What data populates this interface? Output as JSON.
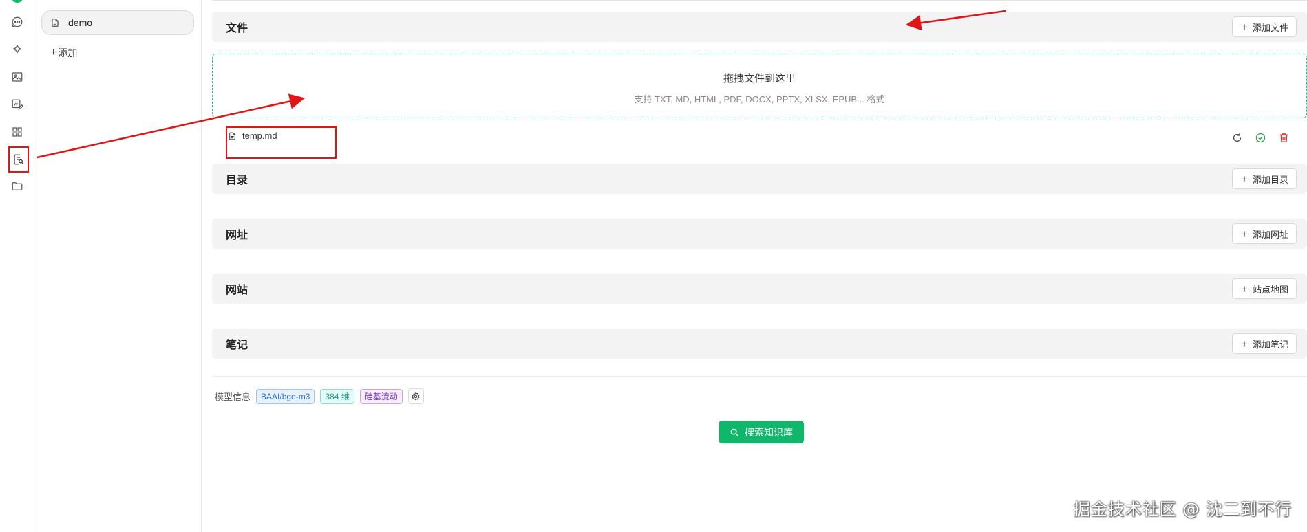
{
  "rail": {
    "icons": [
      "chat-icon",
      "sparkle-icon",
      "image-icon",
      "image-edit-icon",
      "apps-grid-icon",
      "knowledge-base-icon",
      "folder-icon"
    ],
    "active": "knowledge-base-icon"
  },
  "knowledge_list": {
    "items": [
      {
        "label": "demo"
      }
    ],
    "add_label": "添加"
  },
  "sections": {
    "files": {
      "title": "文件",
      "button": "添加文件"
    },
    "directories": {
      "title": "目录",
      "button": "添加目录"
    },
    "urls": {
      "title": "网址",
      "button": "添加网址"
    },
    "websites": {
      "title": "网站",
      "button": "站点地图"
    },
    "notes": {
      "title": "笔记",
      "button": "添加笔记"
    }
  },
  "dropzone": {
    "title": "拖拽文件到这里",
    "subtitle": "支持 TXT, MD, HTML, PDF, DOCX, PPTX, XLSX, EPUB... 格式"
  },
  "files": [
    {
      "name": "temp.md",
      "status": "ok"
    }
  ],
  "model_info": {
    "label": "模型信息",
    "model": "BAAI/bge-m3",
    "dimensions": "384 维",
    "provider": "硅基流动"
  },
  "search_button": "搜索知识库",
  "watermark": "掘金技术社区 @ 沈二到不行",
  "colors": {
    "accent": "#10b76b",
    "annotation": "#e01515",
    "dropzone_border": "#27b38f"
  }
}
